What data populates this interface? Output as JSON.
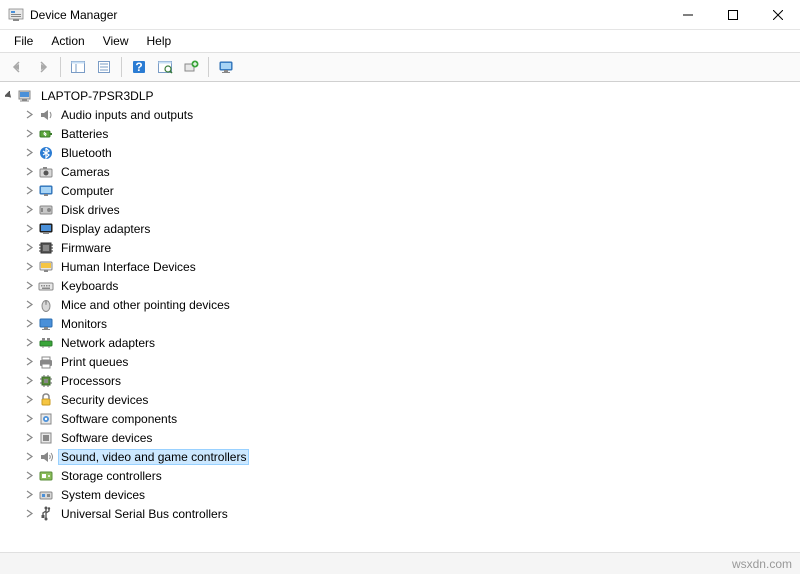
{
  "window": {
    "title": "Device Manager"
  },
  "menu": {
    "file": "File",
    "action": "Action",
    "view": "View",
    "help": "Help"
  },
  "tree": {
    "root": "LAPTOP-7PSR3DLP",
    "items": [
      {
        "label": "Audio inputs and outputs",
        "icon": "audio"
      },
      {
        "label": "Batteries",
        "icon": "battery"
      },
      {
        "label": "Bluetooth",
        "icon": "bluetooth"
      },
      {
        "label": "Cameras",
        "icon": "camera"
      },
      {
        "label": "Computer",
        "icon": "computer"
      },
      {
        "label": "Disk drives",
        "icon": "disk"
      },
      {
        "label": "Display adapters",
        "icon": "display"
      },
      {
        "label": "Firmware",
        "icon": "firmware"
      },
      {
        "label": "Human Interface Devices",
        "icon": "hid"
      },
      {
        "label": "Keyboards",
        "icon": "keyboard"
      },
      {
        "label": "Mice and other pointing devices",
        "icon": "mouse"
      },
      {
        "label": "Monitors",
        "icon": "monitor"
      },
      {
        "label": "Network adapters",
        "icon": "network"
      },
      {
        "label": "Print queues",
        "icon": "printer"
      },
      {
        "label": "Processors",
        "icon": "processor"
      },
      {
        "label": "Security devices",
        "icon": "security"
      },
      {
        "label": "Software components",
        "icon": "swcomp"
      },
      {
        "label": "Software devices",
        "icon": "swdev"
      },
      {
        "label": "Sound, video and game controllers",
        "icon": "sound",
        "selected": true
      },
      {
        "label": "Storage controllers",
        "icon": "storage"
      },
      {
        "label": "System devices",
        "icon": "system"
      },
      {
        "label": "Universal Serial Bus controllers",
        "icon": "usb"
      }
    ]
  },
  "footer": {
    "text": "wsxdn.com"
  }
}
